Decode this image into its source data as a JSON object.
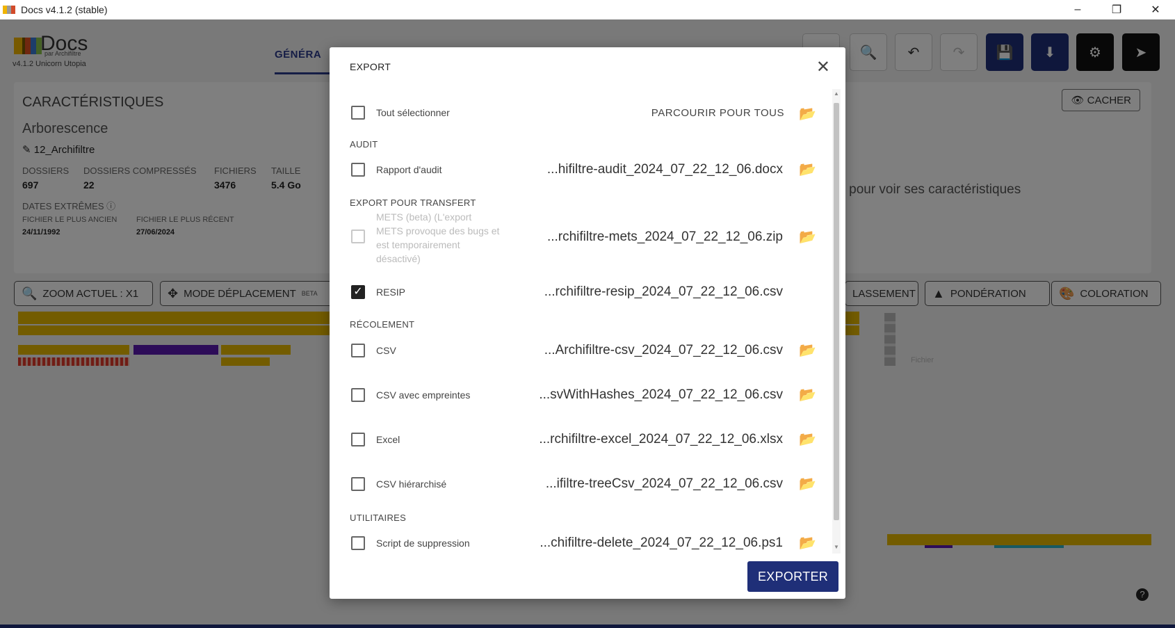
{
  "window": {
    "title": "Docs v4.1.2 (stable)",
    "minimize": "–",
    "restore": "❐",
    "close": "✕"
  },
  "app": {
    "logo": {
      "name": "Docs",
      "by": "par Archifiltre",
      "version": "v4.1.2 Unicorn Utopia"
    },
    "tab_general": "GÉNÉRA",
    "toolbar_icons": [
      "search-icon",
      "undo-icon",
      "redo-icon",
      "save-icon",
      "download-icon",
      "settings-icon",
      "logout-icon"
    ],
    "characteristics": {
      "title": "CARACTÉRISTIQUES",
      "tree_label": "Arborescence",
      "folder_name": "12_Archifiltre",
      "stats": [
        {
          "label": "DOSSIERS",
          "value": "697"
        },
        {
          "label": "DOSSIERS COMPRESSÉS",
          "value": "22"
        },
        {
          "label": "FICHIERS",
          "value": "3476"
        },
        {
          "label": "TAILLE",
          "value": "5.4 Go"
        }
      ],
      "dates_label": "DATES EXTRÊMES",
      "oldest_label": "FICHIER LE PLUS ANCIEN",
      "oldest_value": "24/11/1992",
      "newest_label": "FICHIER LE PLUS RÉCENT",
      "newest_value": "27/06/2024",
      "hide_button": "CACHER",
      "hint": "nt pour voir ses caractéristiques"
    },
    "chips": {
      "zoom": "ZOOM ACTUEL : X1",
      "move_mode": "MODE DÉPLACEMENT",
      "move_mode_badge": "BETA",
      "sorting": "LASSEMENT",
      "weighting": "PONDÉRATION",
      "coloring": "COLORATION"
    },
    "legend_file": "Fichier"
  },
  "modal": {
    "title": "EXPORT",
    "close": "✕",
    "select_all": "Tout sélectionner",
    "browse_all": "PARCOURIR POUR TOUS",
    "sections": {
      "audit": "AUDIT",
      "transfer": "EXPORT POUR TRANSFERT",
      "recolement": "RÉCOLEMENT",
      "utilities": "UTILITAIRES"
    },
    "rows": {
      "audit_report": {
        "label": "Rapport d'audit",
        "file": "...hifiltre-audit_2024_07_22_12_06.docx"
      },
      "mets": {
        "label": "METS (beta) (L'export METS provoque des bugs et est temporairement désactivé)",
        "file": "...rchifiltre-mets_2024_07_22_12_06.zip"
      },
      "resip": {
        "label": "RESIP",
        "file": "...rchifiltre-resip_2024_07_22_12_06.csv"
      },
      "csv": {
        "label": "CSV",
        "file": "...Archifiltre-csv_2024_07_22_12_06.csv"
      },
      "csv_hashes": {
        "label": "CSV avec empreintes",
        "file": "...svWithHashes_2024_07_22_12_06.csv"
      },
      "excel": {
        "label": "Excel",
        "file": "...rchifiltre-excel_2024_07_22_12_06.xlsx"
      },
      "csv_tree": {
        "label": "CSV hiérarchisé",
        "file": "...ifiltre-treeCsv_2024_07_22_12_06.csv"
      },
      "delete_script": {
        "label": "Script de suppression",
        "file": "...chifiltre-delete_2024_07_22_12_06.ps1"
      }
    },
    "export_button": "EXPORTER"
  }
}
